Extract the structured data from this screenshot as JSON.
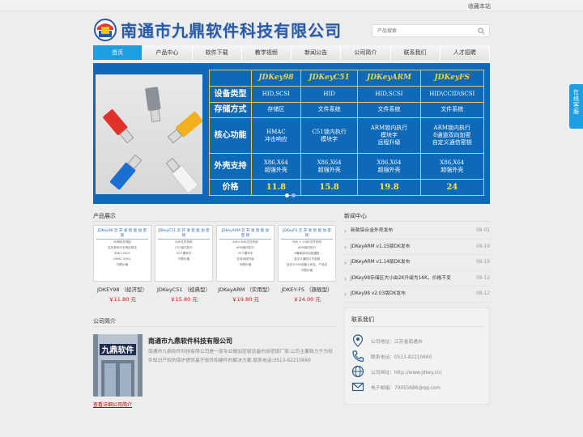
{
  "topbar": {
    "favorite": "收藏本站"
  },
  "header": {
    "company": "南通市九鼎软件科技有限公司",
    "search_placeholder": "产品搜索"
  },
  "nav": [
    {
      "label": "首页",
      "active": true
    },
    {
      "label": "产品中心"
    },
    {
      "label": "软件下载"
    },
    {
      "label": "教学视频"
    },
    {
      "label": "新闻公告"
    },
    {
      "label": "公司简介"
    },
    {
      "label": "联系我们"
    },
    {
      "label": "人才招聘"
    }
  ],
  "banner": {
    "columns": [
      "JDKey98",
      "JDKeyC51",
      "JDKeyARM",
      "JDKeyFS"
    ],
    "rows": [
      {
        "label": "设备类型",
        "values": [
          "HID,SCSI",
          "HID",
          "HID,SCSI",
          "HID\\CCID\\SCSI"
        ]
      },
      {
        "label": "存储方式",
        "values": [
          "存储区",
          "文件系统",
          "文件系统",
          "文件系统"
        ]
      },
      {
        "label": "核心功能",
        "values": [
          "HMAC\n冲击响应",
          "C51锁内执行\n模块字",
          "ARM锁内执行\n模块字\n远程升级",
          "ARM锁内执行\n8通道双向加密\n自定义通信密钥"
        ]
      },
      {
        "label": "外壳支持",
        "values": [
          "X86,X64\n超强外壳",
          "X86,X64\n超强外壳",
          "X86,X64\n超强外壳",
          "X86,X64\n超强外壳"
        ]
      },
      {
        "label": "价格",
        "values": [
          "11.8",
          "15.8",
          "19.8",
          "24"
        ]
      }
    ],
    "slides": 2
  },
  "products": {
    "title": "产品展示",
    "items": [
      {
        "card_title": "JDKey98 云 开 发 智 能 加 密 锁",
        "lines": [
          "2K两轮存储区",
          "支持多种冲击响应算法",
          "SDK1.0001",
          "HMAC SHA1",
          "HMAC_SHA256",
          "",
          "列表价格"
        ],
        "name": "JDKEY98 （经济型）",
        "price": "￥11.80 元"
      },
      {
        "card_title": "JDKeyC51 云 开 发 智 能 加 密 锁",
        "lines": [
          "64K文件系统",
          "C51锁内执行",
          "32个模块字",
          "",
          "",
          "",
          "列表价格"
        ],
        "name": "JDKeyC51 （经典型）",
        "price": "￥15.80 元"
      },
      {
        "card_title": "JDKeyARM 云 开 发 智 能 加 密 锁",
        "lines": [
          "64K+64K文件系统",
          "ARM锁内执行",
          "32个模块字",
          "支持远程升级",
          "",
          "",
          "列表价格"
        ],
        "name": "JDKeyARM （实用型）",
        "price": "￥19.80 元"
      },
      {
        "card_title": "JDKeyFS 云 开 发 智 能 加 密 锁",
        "lines": [
          "96K + 128K文件系统",
          "ARM锁内执行",
          "8通道双向加密通信",
          "自定义通信口令密钥",
          "自定义USB设备公司名，产品名",
          "",
          "列表价格"
        ],
        "name": "JDKEY-FS （旗舰型）",
        "price": "￥24.00 元"
      }
    ]
  },
  "news": {
    "title": "新闻中心",
    "items": [
      {
        "text": "新款铝合金外壳发布",
        "date": "08-01"
      },
      {
        "text": "JDKeyARM v1.15版DK发布",
        "date": "09-19"
      },
      {
        "text": "JDKeyARM v1.14版DK发布",
        "date": "08-19"
      },
      {
        "text": "JDKey98存储区大小由2K升级为16K，价格不变",
        "date": "08-12"
      },
      {
        "text": "JDKey98 v2.03版DK发布",
        "date": "08-12"
      }
    ]
  },
  "about": {
    "title": "公司简介",
    "company": "南通市九鼎软件科技有限公司",
    "text": "南通市九鼎软件科技有限公司是一家专业做加密锁设备的加密锁厂家,公司主要致力于为软件知识产权的保护提供基于软件和硬件的解决方案.联系电话:0513-82210660",
    "more": "查看详细公司简介",
    "sign": "九鼎软件"
  },
  "contact": {
    "title": "联系我们",
    "rows": [
      {
        "icon": "location-icon",
        "text": "公司地址：江苏省南通市"
      },
      {
        "icon": "phone-icon",
        "text": "联系电话：0513-82210660"
      },
      {
        "icon": "globe-icon",
        "text": "公司网址：http://www.jdkey.cn/"
      },
      {
        "icon": "mail-icon",
        "text": "电子邮箱：79055686@qq.com"
      }
    ]
  },
  "side_tab": "在线客服",
  "colors": {
    "accent": "#1e9fe3",
    "banner": "#0e69b8",
    "price": "#d4131b",
    "company": "#2a5aa4"
  }
}
